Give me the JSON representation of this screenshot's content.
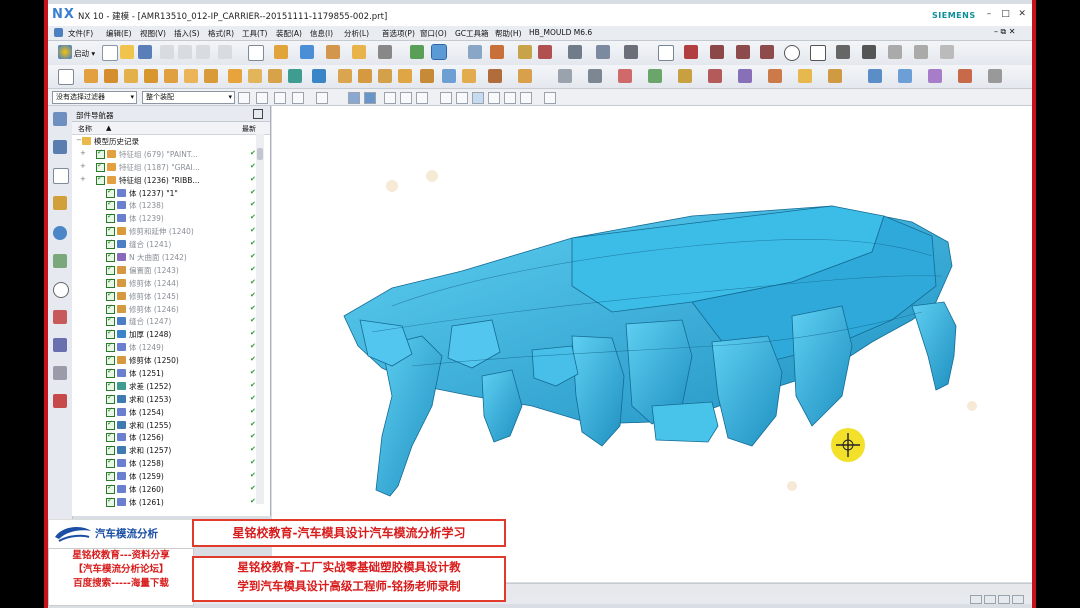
{
  "window": {
    "logo": "NX",
    "title": "NX 10 - 建模 - [AMR13510_012-IP_CARRIER--20151111-1179855-002.prt]",
    "brand": "SIEMENS"
  },
  "menu": [
    "文件(F)",
    "编辑(E)",
    "视图(V)",
    "插入(S)",
    "格式(R)",
    "工具(T)",
    "装配(A)",
    "信息(I)",
    "分析(L)",
    "首选项(P)",
    "窗口(O)",
    "GC工具箱",
    "帮助(H)",
    "HB_MOULD M6.6"
  ],
  "toolbar": {
    "start_label": "启动 ▾"
  },
  "selection": {
    "filter": "没有选择过滤器",
    "scope": "整个装配"
  },
  "navigator": {
    "title": "部件导航器",
    "col_name": "名称",
    "col_latest": "最新",
    "rows": [
      {
        "label": "模型历史记录",
        "indent": 0,
        "dim": false,
        "icon": "folder-icon"
      },
      {
        "label": "特征组 (679) \"PAINT...",
        "indent": 1,
        "dim": true,
        "icon": "feature-group-icon"
      },
      {
        "label": "特征组 (1187) \"GRAI...",
        "indent": 1,
        "dim": true,
        "icon": "feature-group-icon"
      },
      {
        "label": "特征组 (1236) \"RIBB...",
        "indent": 1,
        "dim": false,
        "icon": "feature-group-icon"
      },
      {
        "label": "体 (1237) \"1\"",
        "indent": 2,
        "dim": false,
        "icon": "body-icon"
      },
      {
        "label": "体 (1238)",
        "indent": 2,
        "dim": true,
        "icon": "body-icon"
      },
      {
        "label": "体 (1239)",
        "indent": 2,
        "dim": true,
        "icon": "body-icon"
      },
      {
        "label": "修剪和延伸 (1240)",
        "indent": 2,
        "dim": true,
        "icon": "trim-icon"
      },
      {
        "label": "缝合 (1241)",
        "indent": 2,
        "dim": true,
        "icon": "sew-icon"
      },
      {
        "label": "N 大曲面 (1242)",
        "indent": 2,
        "dim": true,
        "icon": "surface-icon"
      },
      {
        "label": "偏置面 (1243)",
        "indent": 2,
        "dim": true,
        "icon": "offset-icon"
      },
      {
        "label": "修剪体 (1244)",
        "indent": 2,
        "dim": true,
        "icon": "trim-body-icon"
      },
      {
        "label": "修剪体 (1245)",
        "indent": 2,
        "dim": true,
        "icon": "trim-body-icon"
      },
      {
        "label": "修剪体 (1246)",
        "indent": 2,
        "dim": true,
        "icon": "trim-body-icon"
      },
      {
        "label": "缝合 (1247)",
        "indent": 2,
        "dim": true,
        "icon": "sew-icon"
      },
      {
        "label": "加厚 (1248)",
        "indent": 2,
        "dim": false,
        "icon": "thicken-icon"
      },
      {
        "label": "体 (1249)",
        "indent": 2,
        "dim": true,
        "icon": "body-icon"
      },
      {
        "label": "修剪体 (1250)",
        "indent": 2,
        "dim": false,
        "icon": "trim-body-icon"
      },
      {
        "label": "体 (1251)",
        "indent": 2,
        "dim": false,
        "icon": "body-icon"
      },
      {
        "label": "求差 (1252)",
        "indent": 2,
        "dim": false,
        "icon": "subtract-icon"
      },
      {
        "label": "求和 (1253)",
        "indent": 2,
        "dim": false,
        "icon": "unite-icon"
      },
      {
        "label": "体 (1254)",
        "indent": 2,
        "dim": false,
        "icon": "body-icon"
      },
      {
        "label": "求和 (1255)",
        "indent": 2,
        "dim": false,
        "icon": "unite-icon"
      },
      {
        "label": "体 (1256)",
        "indent": 2,
        "dim": false,
        "icon": "body-icon"
      },
      {
        "label": "求和 (1257)",
        "indent": 2,
        "dim": false,
        "icon": "unite-icon"
      },
      {
        "label": "体 (1258)",
        "indent": 2,
        "dim": false,
        "icon": "body-icon"
      },
      {
        "label": "体 (1259)",
        "indent": 2,
        "dim": false,
        "icon": "body-icon"
      },
      {
        "label": "体 (1260)",
        "indent": 2,
        "dim": false,
        "icon": "body-icon"
      },
      {
        "label": "体 (1261)",
        "indent": 2,
        "dim": false,
        "icon": "body-icon"
      }
    ]
  },
  "viewport": {
    "model": "IP carrier instrument panel 3D model",
    "model_color": "#33b9e6",
    "cursor": "move-cursor-icon"
  },
  "overlay": {
    "logo_text": "汽车模流分析",
    "left_lines": [
      "星铭校教育---资料分享",
      "【汽车模流分析论坛】",
      "百度搜索-----海量下载"
    ],
    "banner_top": "星铭校教育-汽车模具设计汽车模流分析学习",
    "banner_bottom": [
      "星铭校教育-工厂实战零基础塑胶模具设计教",
      "学到汽车模具设计高级工程师-铭扬老师录制"
    ]
  },
  "colors": {
    "frame_red": "#c6121b",
    "overlay_red": "#d81c1c",
    "accent_blue": "#3b7fd0"
  }
}
